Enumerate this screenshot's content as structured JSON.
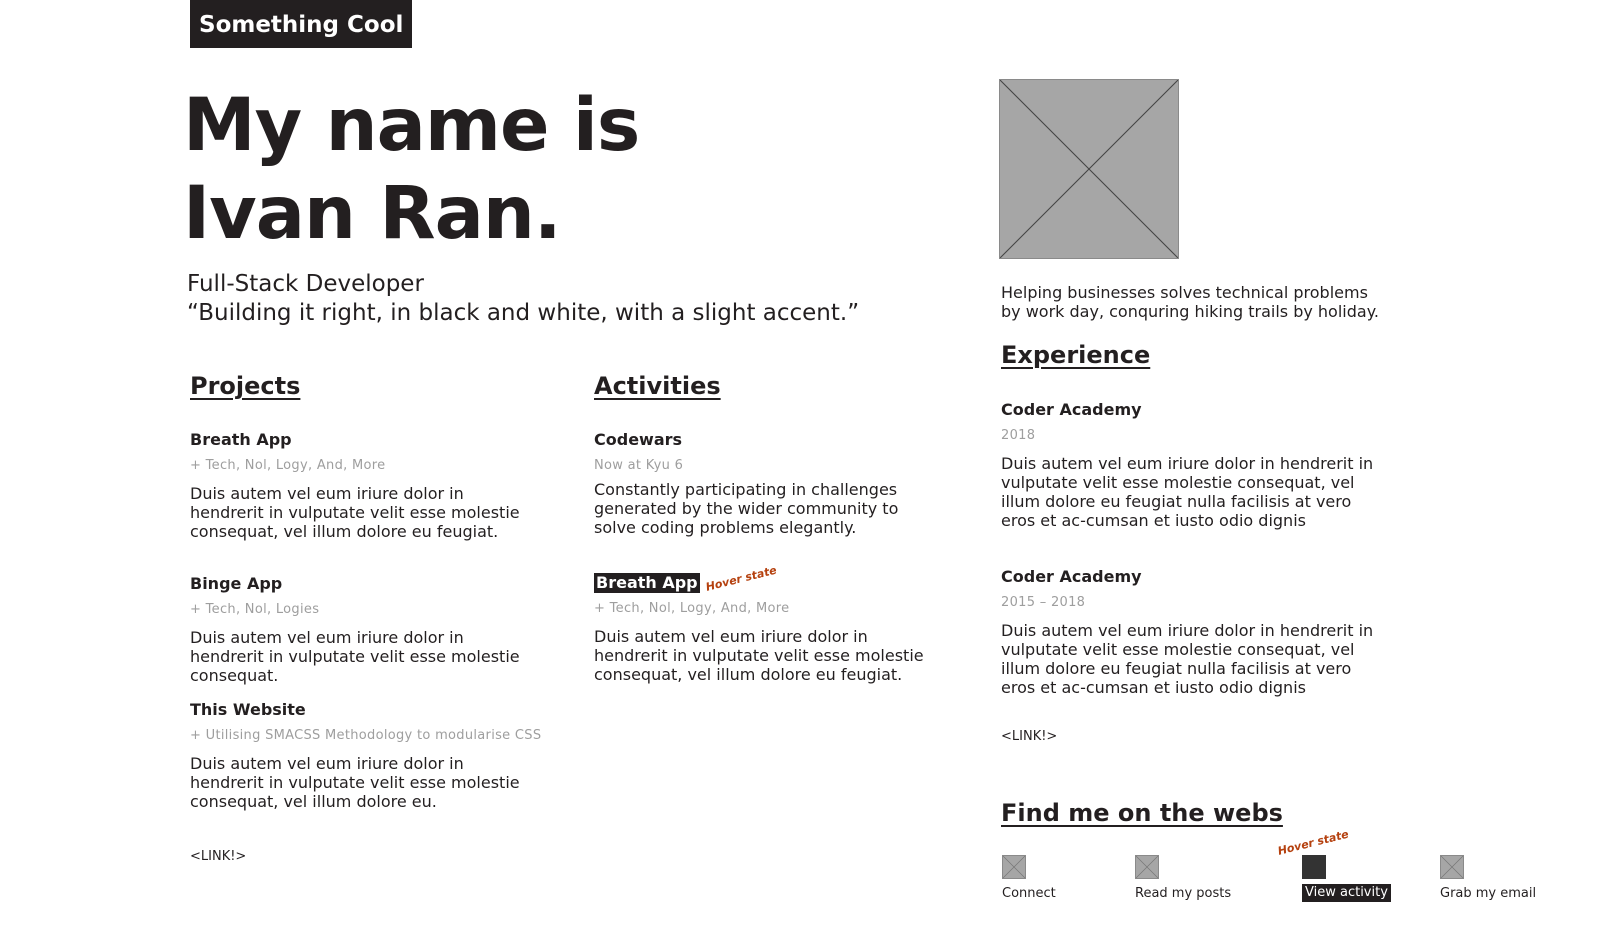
{
  "brand": "Something Cool",
  "hero": {
    "line1": "My name is",
    "line2": "Ivan Ran."
  },
  "role": "Full-Stack Developer",
  "tagline": "“Building it right, in black and white, with a slight accent.”",
  "about": "Helping businesses solves technical problems by work day, conquring hiking trails by holiday.",
  "projects": {
    "heading": "Projects",
    "items": [
      {
        "title": "Breath App",
        "meta": "+ Tech, Nol, Logy, And, More",
        "body": "Duis autem vel eum iriure dolor in hendrerit in vulputate velit esse molestie consequat, vel illum dolore eu feugiat."
      },
      {
        "title": "Binge App",
        "meta": "+ Tech, Nol, Logies",
        "body": "Duis autem vel eum iriure dolor in hendrerit in vulputate velit esse molestie consequat."
      },
      {
        "title": "This Website",
        "meta": "+ Utilising SMACSS Methodology to modularise CSS",
        "body": "Duis autem vel eum iriure dolor in hendrerit in vulputate velit esse molestie consequat, vel illum dolore eu."
      }
    ],
    "link": "<LINK!>"
  },
  "activities": {
    "heading": "Activities",
    "items": [
      {
        "title": "Codewars",
        "meta": "Now at Kyu 6",
        "body": "Constantly participating in challenges generated by the wider community to solve coding problems elegantly."
      },
      {
        "title": "Breath App",
        "meta": "+ Tech, Nol, Logy, And, More",
        "body": "Duis autem vel eum iriure dolor in hendrerit in vulputate velit esse molestie consequat, vel illum dolore eu feugiat."
      }
    ],
    "hover_note": "Hover state"
  },
  "experience": {
    "heading": "Experience",
    "items": [
      {
        "title": "Coder Academy",
        "meta": "2018",
        "body": "Duis autem vel eum iriure dolor in hendrerit in vulputate velit esse molestie consequat, vel illum dolore eu feugiat nulla facilisis at vero eros et ac-cumsan et iusto odio dignis"
      },
      {
        "title": "Coder Academy",
        "meta": "2015 – 2018",
        "body": "Duis autem vel eum iriure dolor in hendrerit in vulputate velit esse molestie consequat, vel illum dolore eu feugiat nulla facilisis at vero eros et ac-cumsan et iusto odio dignis"
      }
    ],
    "link": "<LINK!>"
  },
  "social": {
    "heading": "Find me on the webs",
    "hover_note": "Hover state",
    "links": [
      {
        "label": "Connect",
        "icon": "placeholder-icon"
      },
      {
        "label": "Read my posts",
        "icon": "placeholder-icon"
      },
      {
        "label": "View activity",
        "icon": "placeholder-icon"
      },
      {
        "label": "Grab my email",
        "icon": "placeholder-icon"
      }
    ]
  },
  "colors": {
    "dark": "#231f20",
    "accent": "#b5410f",
    "meta": "#9e9e9e",
    "placeholder": "#a6a6a6"
  }
}
